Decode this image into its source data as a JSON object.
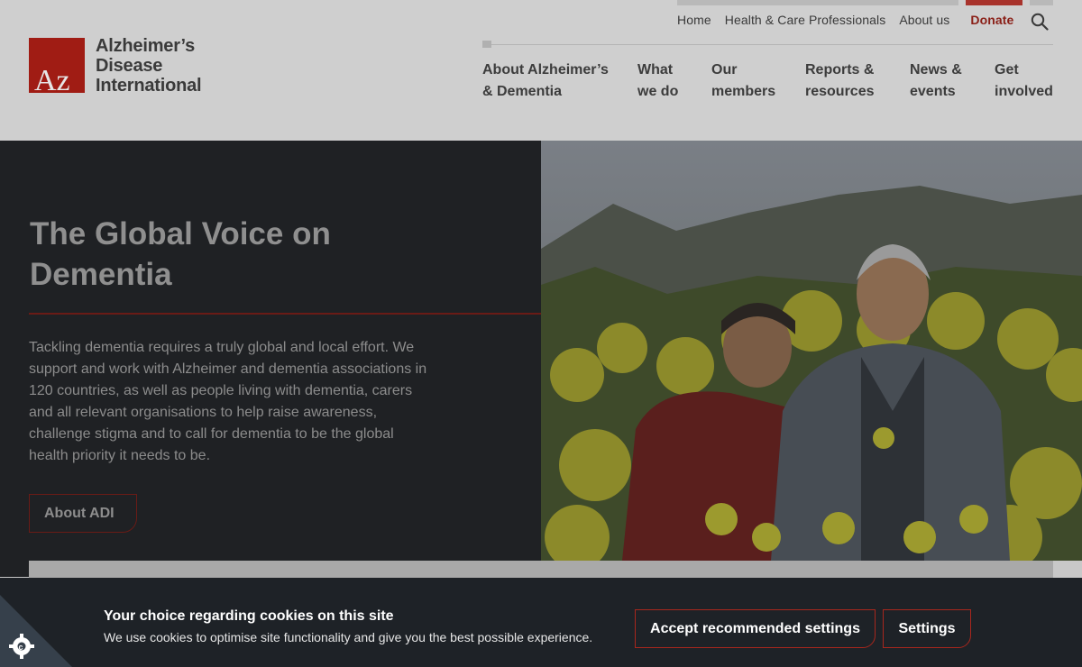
{
  "header": {
    "util_links": [
      "Home",
      "Health & Care Professionals",
      "About us"
    ],
    "donate": "Donate",
    "search_icon": "search-icon",
    "logo_mark": "Az",
    "logo_lines": [
      "Alzheimer’s",
      "Disease",
      "International"
    ],
    "nav": [
      {
        "line1": "About Alzheimer’s",
        "line2": "& Dementia"
      },
      {
        "line1": "What",
        "line2": "we do"
      },
      {
        "line1": "Our",
        "line2": "members"
      },
      {
        "line1": "Reports &",
        "line2": "resources"
      },
      {
        "line1": "News &",
        "line2": "events"
      },
      {
        "line1": "Get",
        "line2": "involved"
      }
    ]
  },
  "hero": {
    "title_line1": "The Global Voice on",
    "title_line2": "Dementia",
    "body": "Tackling dementia requires a truly global and local effort. We support and work with Alzheimer and dementia associations in 120 countries, as well as people living with dementia, carers and all relevant organisations to help raise awareness, challenge stigma and to call for dementia to be the global health priority it needs to be.",
    "button": "About ADI"
  },
  "cookie": {
    "title": "Your choice regarding cookies on this site",
    "desc": "We use cookies to optimise site functionality and give you the best possible experience.",
    "accept": "Accept recommended settings",
    "settings": "Settings",
    "corner_icon": "cookie-gear-icon"
  },
  "colors": {
    "accent": "#a8271d",
    "dark": "#1e2227"
  }
}
